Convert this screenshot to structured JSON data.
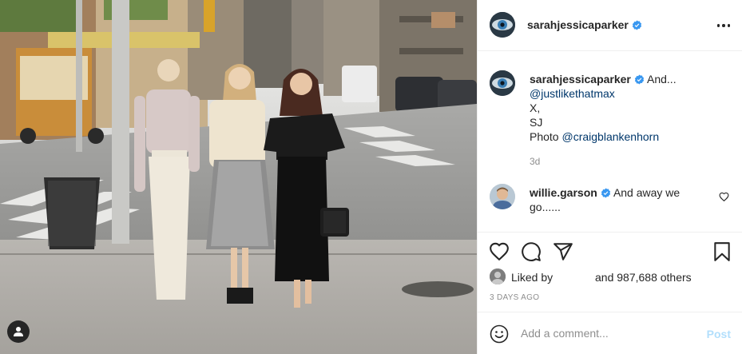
{
  "post": {
    "author": {
      "username": "sarahjessicaparker",
      "verified": true
    },
    "more_icon": "more-horizontal-icon",
    "tag_icon": "user-tag-icon"
  },
  "caption": {
    "username": "sarahjessicaparker",
    "lines": [
      "And...",
      "@justlikethatmax",
      "X,",
      "SJ",
      "Photo @craigblankenhorn"
    ],
    "mentions": [
      "@justlikethatmax",
      "@craigblankenhorn"
    ],
    "photo_prefix": "Photo ",
    "time_ago": "3d"
  },
  "comments": [
    {
      "username": "willie.garson",
      "verified": true,
      "text": "And away we go......"
    }
  ],
  "actions": {
    "icons": [
      "heart-icon",
      "comment-icon",
      "share-icon",
      "bookmark-icon"
    ]
  },
  "likes": {
    "prefix": "Liked by",
    "rest": "and 987,688 others"
  },
  "date": "3 DAYS AGO",
  "add_comment": {
    "placeholder": "Add a comment...",
    "post_label": "Post"
  },
  "colors": {
    "verified_blue": "#3897f0",
    "link_blue": "#00376b",
    "post_disabled": "#b2dffc",
    "secondary_text": "#8e8e8e"
  }
}
